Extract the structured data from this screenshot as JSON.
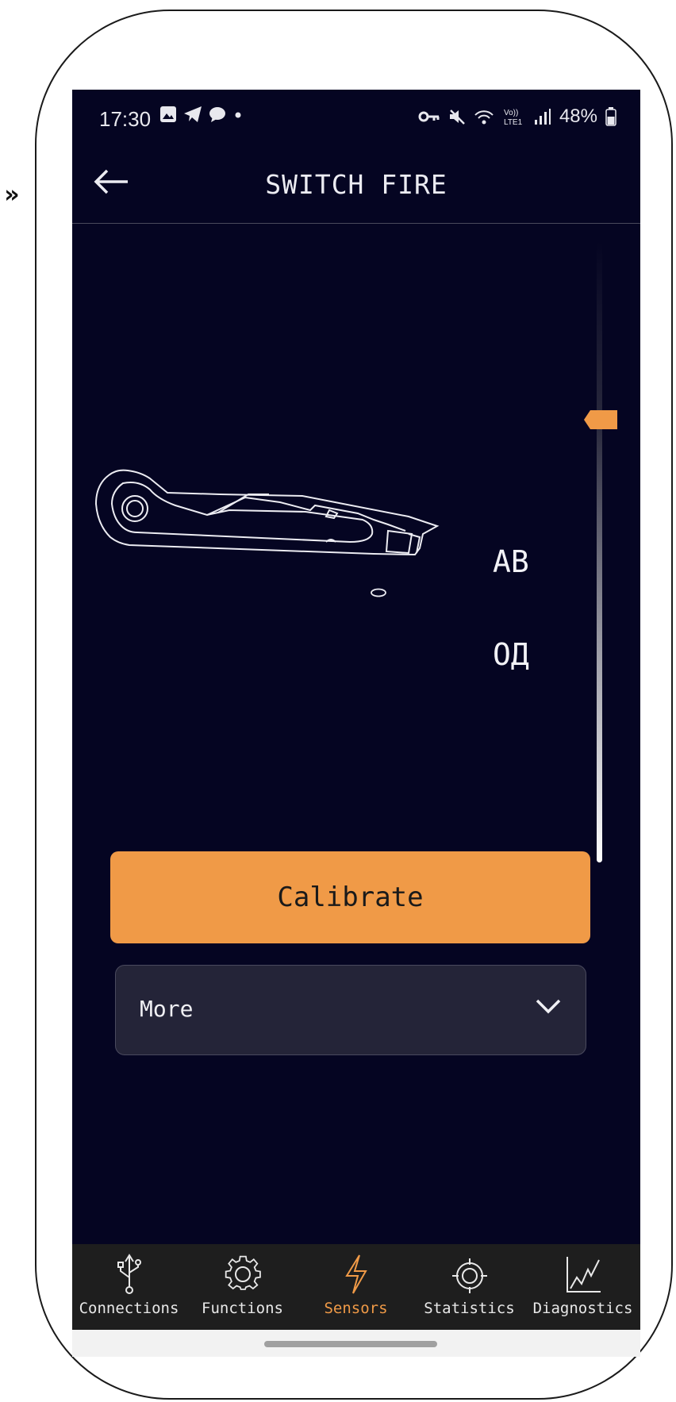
{
  "status_bar": {
    "time": "17:30",
    "battery": "48%",
    "icons": [
      "gallery-icon",
      "telegram-icon",
      "chat-icon",
      "dot-icon",
      "vpn-key-icon",
      "mute-icon",
      "wifi-icon",
      "volte-icon",
      "signal-icon",
      "battery-icon"
    ]
  },
  "header": {
    "title": "SWITCH FIRE",
    "back_icon": "back-arrow-icon"
  },
  "sensor": {
    "label_ab": "АВ",
    "label_od": "ОД",
    "slider_level": 0.37
  },
  "actions": {
    "calibrate_label": "Calibrate",
    "more_label": "More"
  },
  "nav": {
    "active": "Sensors",
    "items": [
      {
        "label": "Connections",
        "icon": "usb-icon"
      },
      {
        "label": "Functions",
        "icon": "gear-icon"
      },
      {
        "label": "Sensors",
        "icon": "lightning-icon"
      },
      {
        "label": "Statistics",
        "icon": "target-icon"
      },
      {
        "label": "Diagnostics",
        "icon": "chart-line-icon"
      }
    ]
  },
  "colors": {
    "background": "#050522",
    "accent": "#f09a47",
    "dropdown": "#242438",
    "nav_bar": "#1e1e1e"
  }
}
